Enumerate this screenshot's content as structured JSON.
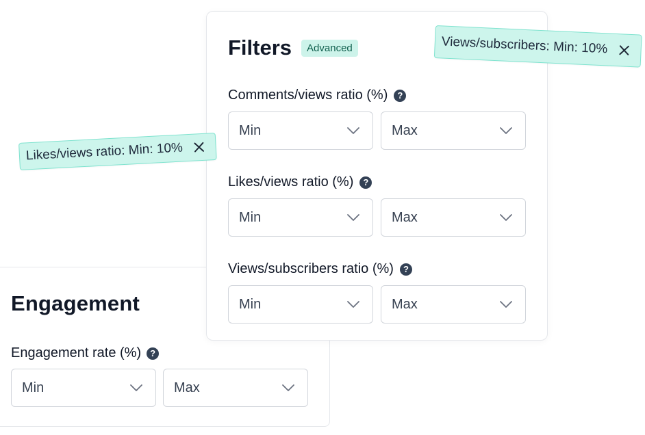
{
  "engagement": {
    "title": "Engagement",
    "field": {
      "label": "Engagement rate (%)",
      "help_icon": "?",
      "min_placeholder": "Min",
      "max_placeholder": "Max"
    }
  },
  "filters": {
    "title": "Filters",
    "badge": "Advanced",
    "fields": [
      {
        "label": "Comments/views ratio (%)",
        "help_icon": "?",
        "min_placeholder": "Min",
        "max_placeholder": "Max"
      },
      {
        "label": "Likes/views ratio (%)",
        "help_icon": "?",
        "min_placeholder": "Min",
        "max_placeholder": "Max"
      },
      {
        "label": "Views/subscribers ratio (%)",
        "help_icon": "?",
        "min_placeholder": "Min",
        "max_placeholder": "Max"
      }
    ]
  },
  "chips": [
    {
      "label": "Views/subscribers: Min: 10%",
      "icon": "close-icon"
    },
    {
      "label": "Likes/views ratio: Min: 10%",
      "icon": "close-icon"
    }
  ],
  "colors": {
    "badge_bg": "#cdf3ea",
    "chip_bg": "#cdf5ec",
    "chip_border": "#7fe3cf",
    "text_dark": "#111827",
    "help_icon_bg": "#334155"
  }
}
